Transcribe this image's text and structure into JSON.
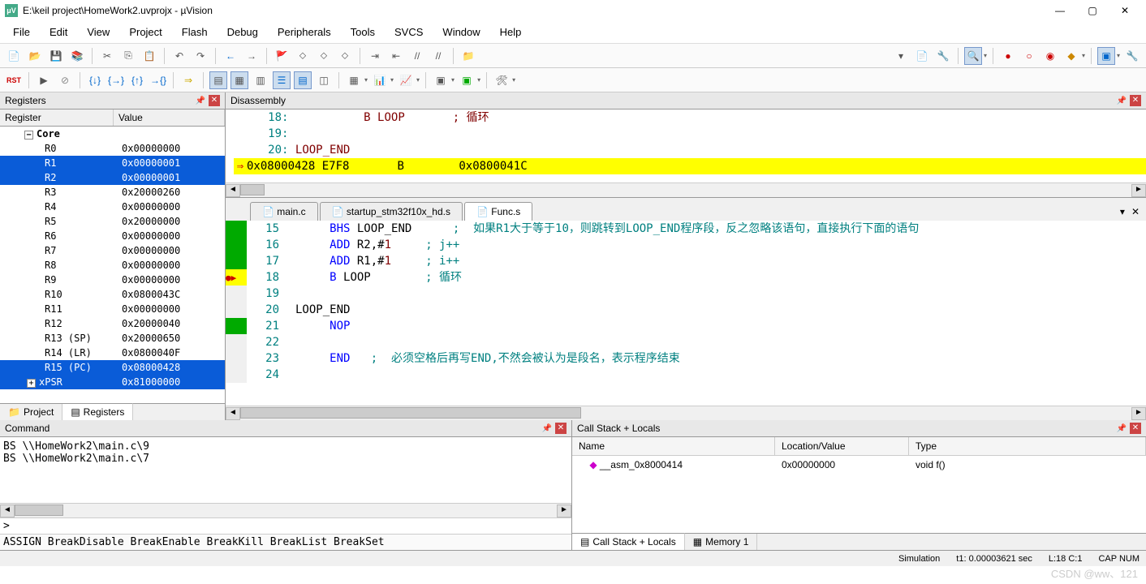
{
  "title": "E:\\keil project\\HomeWork2.uvprojx - µVision",
  "menu": [
    "File",
    "Edit",
    "View",
    "Project",
    "Flash",
    "Debug",
    "Peripherals",
    "Tools",
    "SVCS",
    "Window",
    "Help"
  ],
  "registers": {
    "title": "Registers",
    "col1": "Register",
    "col2": "Value",
    "core_label": "Core",
    "rows": [
      {
        "n": "R0",
        "v": "0x00000000",
        "sel": false
      },
      {
        "n": "R1",
        "v": "0x00000001",
        "sel": true
      },
      {
        "n": "R2",
        "v": "0x00000001",
        "sel": true
      },
      {
        "n": "R3",
        "v": "0x20000260",
        "sel": false
      },
      {
        "n": "R4",
        "v": "0x00000000",
        "sel": false
      },
      {
        "n": "R5",
        "v": "0x20000000",
        "sel": false
      },
      {
        "n": "R6",
        "v": "0x00000000",
        "sel": false
      },
      {
        "n": "R7",
        "v": "0x00000000",
        "sel": false
      },
      {
        "n": "R8",
        "v": "0x00000000",
        "sel": false
      },
      {
        "n": "R9",
        "v": "0x00000000",
        "sel": false
      },
      {
        "n": "R10",
        "v": "0x0800043C",
        "sel": false
      },
      {
        "n": "R11",
        "v": "0x00000000",
        "sel": false
      },
      {
        "n": "R12",
        "v": "0x20000040",
        "sel": false
      },
      {
        "n": "R13 (SP)",
        "v": "0x20000650",
        "sel": false
      },
      {
        "n": "R14 (LR)",
        "v": "0x0800040F",
        "sel": false
      },
      {
        "n": "R15 (PC)",
        "v": "0x08000428",
        "sel": true
      },
      {
        "n": "xPSR",
        "v": "0x81000000",
        "sel": true
      }
    ],
    "tabs": {
      "project": "Project",
      "registers": "Registers"
    }
  },
  "disasm": {
    "title": "Disassembly",
    "lines": [
      {
        "ln": "18:",
        "asm": "           B LOOP       ; 循环",
        "hl": false
      },
      {
        "ln": "19:",
        "asm": "",
        "hl": false
      },
      {
        "ln": "20:",
        "asm": "LOOP_END",
        "hl": false
      }
    ],
    "hl_line": {
      "addr": "0x08000428",
      "op": "E7F8",
      "mnem": "B",
      "target": "0x0800041C"
    }
  },
  "source": {
    "tabs": [
      {
        "label": "main.c",
        "active": false
      },
      {
        "label": "startup_stm32f10x_hd.s",
        "active": false
      },
      {
        "label": "Func.s",
        "active": true
      }
    ],
    "lines": [
      {
        "n": 15,
        "g": "g",
        "txt": "BHS LOOP_END      ;  如果R1大于等于10，则跳转到LOOP_END程序段，反之忽略该语句，直接执行下面的语句",
        "kw": [
          "BHS"
        ]
      },
      {
        "n": 16,
        "g": "g",
        "txt": "ADD R2,#1     ; j++",
        "kw": [
          "ADD"
        ],
        "num": "1"
      },
      {
        "n": 17,
        "g": "g",
        "txt": "ADD R1,#1     ; i++",
        "kw": [
          "ADD"
        ],
        "num": "1"
      },
      {
        "n": 18,
        "g": "hl",
        "txt": "B LOOP        ; 循环",
        "kw": [
          "B"
        ]
      },
      {
        "n": 19,
        "g": "p",
        "txt": ""
      },
      {
        "n": 20,
        "g": "p",
        "txt": "LOOP_END",
        "label": true
      },
      {
        "n": 21,
        "g": "g",
        "txt": "NOP",
        "kw": [
          "NOP"
        ]
      },
      {
        "n": 22,
        "g": "p",
        "txt": ""
      },
      {
        "n": 23,
        "g": "p",
        "txt": "END   ;  必须空格后再写END,不然会被认为是段名，表示程序结束",
        "kw": [
          "END"
        ]
      },
      {
        "n": 24,
        "g": "p",
        "txt": ""
      }
    ]
  },
  "command": {
    "title": "Command",
    "lines": [
      "BS \\\\HomeWork2\\main.c\\9",
      "BS \\\\HomeWork2\\main.c\\7"
    ],
    "prompt": ">",
    "footer": "ASSIGN BreakDisable BreakEnable BreakKill BreakList BreakSet"
  },
  "callstack": {
    "title": "Call Stack + Locals",
    "cols": {
      "name": "Name",
      "loc": "Location/Value",
      "type": "Type"
    },
    "rows": [
      {
        "name": "__asm_0x8000414",
        "loc": "0x00000000",
        "type": "void f()"
      }
    ],
    "tabs": {
      "calls": "Call Stack + Locals",
      "mem": "Memory 1"
    }
  },
  "status": {
    "sim": "Simulation",
    "t1": "t1: 0.00003621 sec",
    "pos": "L:18 C:1",
    "caps": "CAP NUM"
  },
  "watermark": "CSDN @ww、121"
}
